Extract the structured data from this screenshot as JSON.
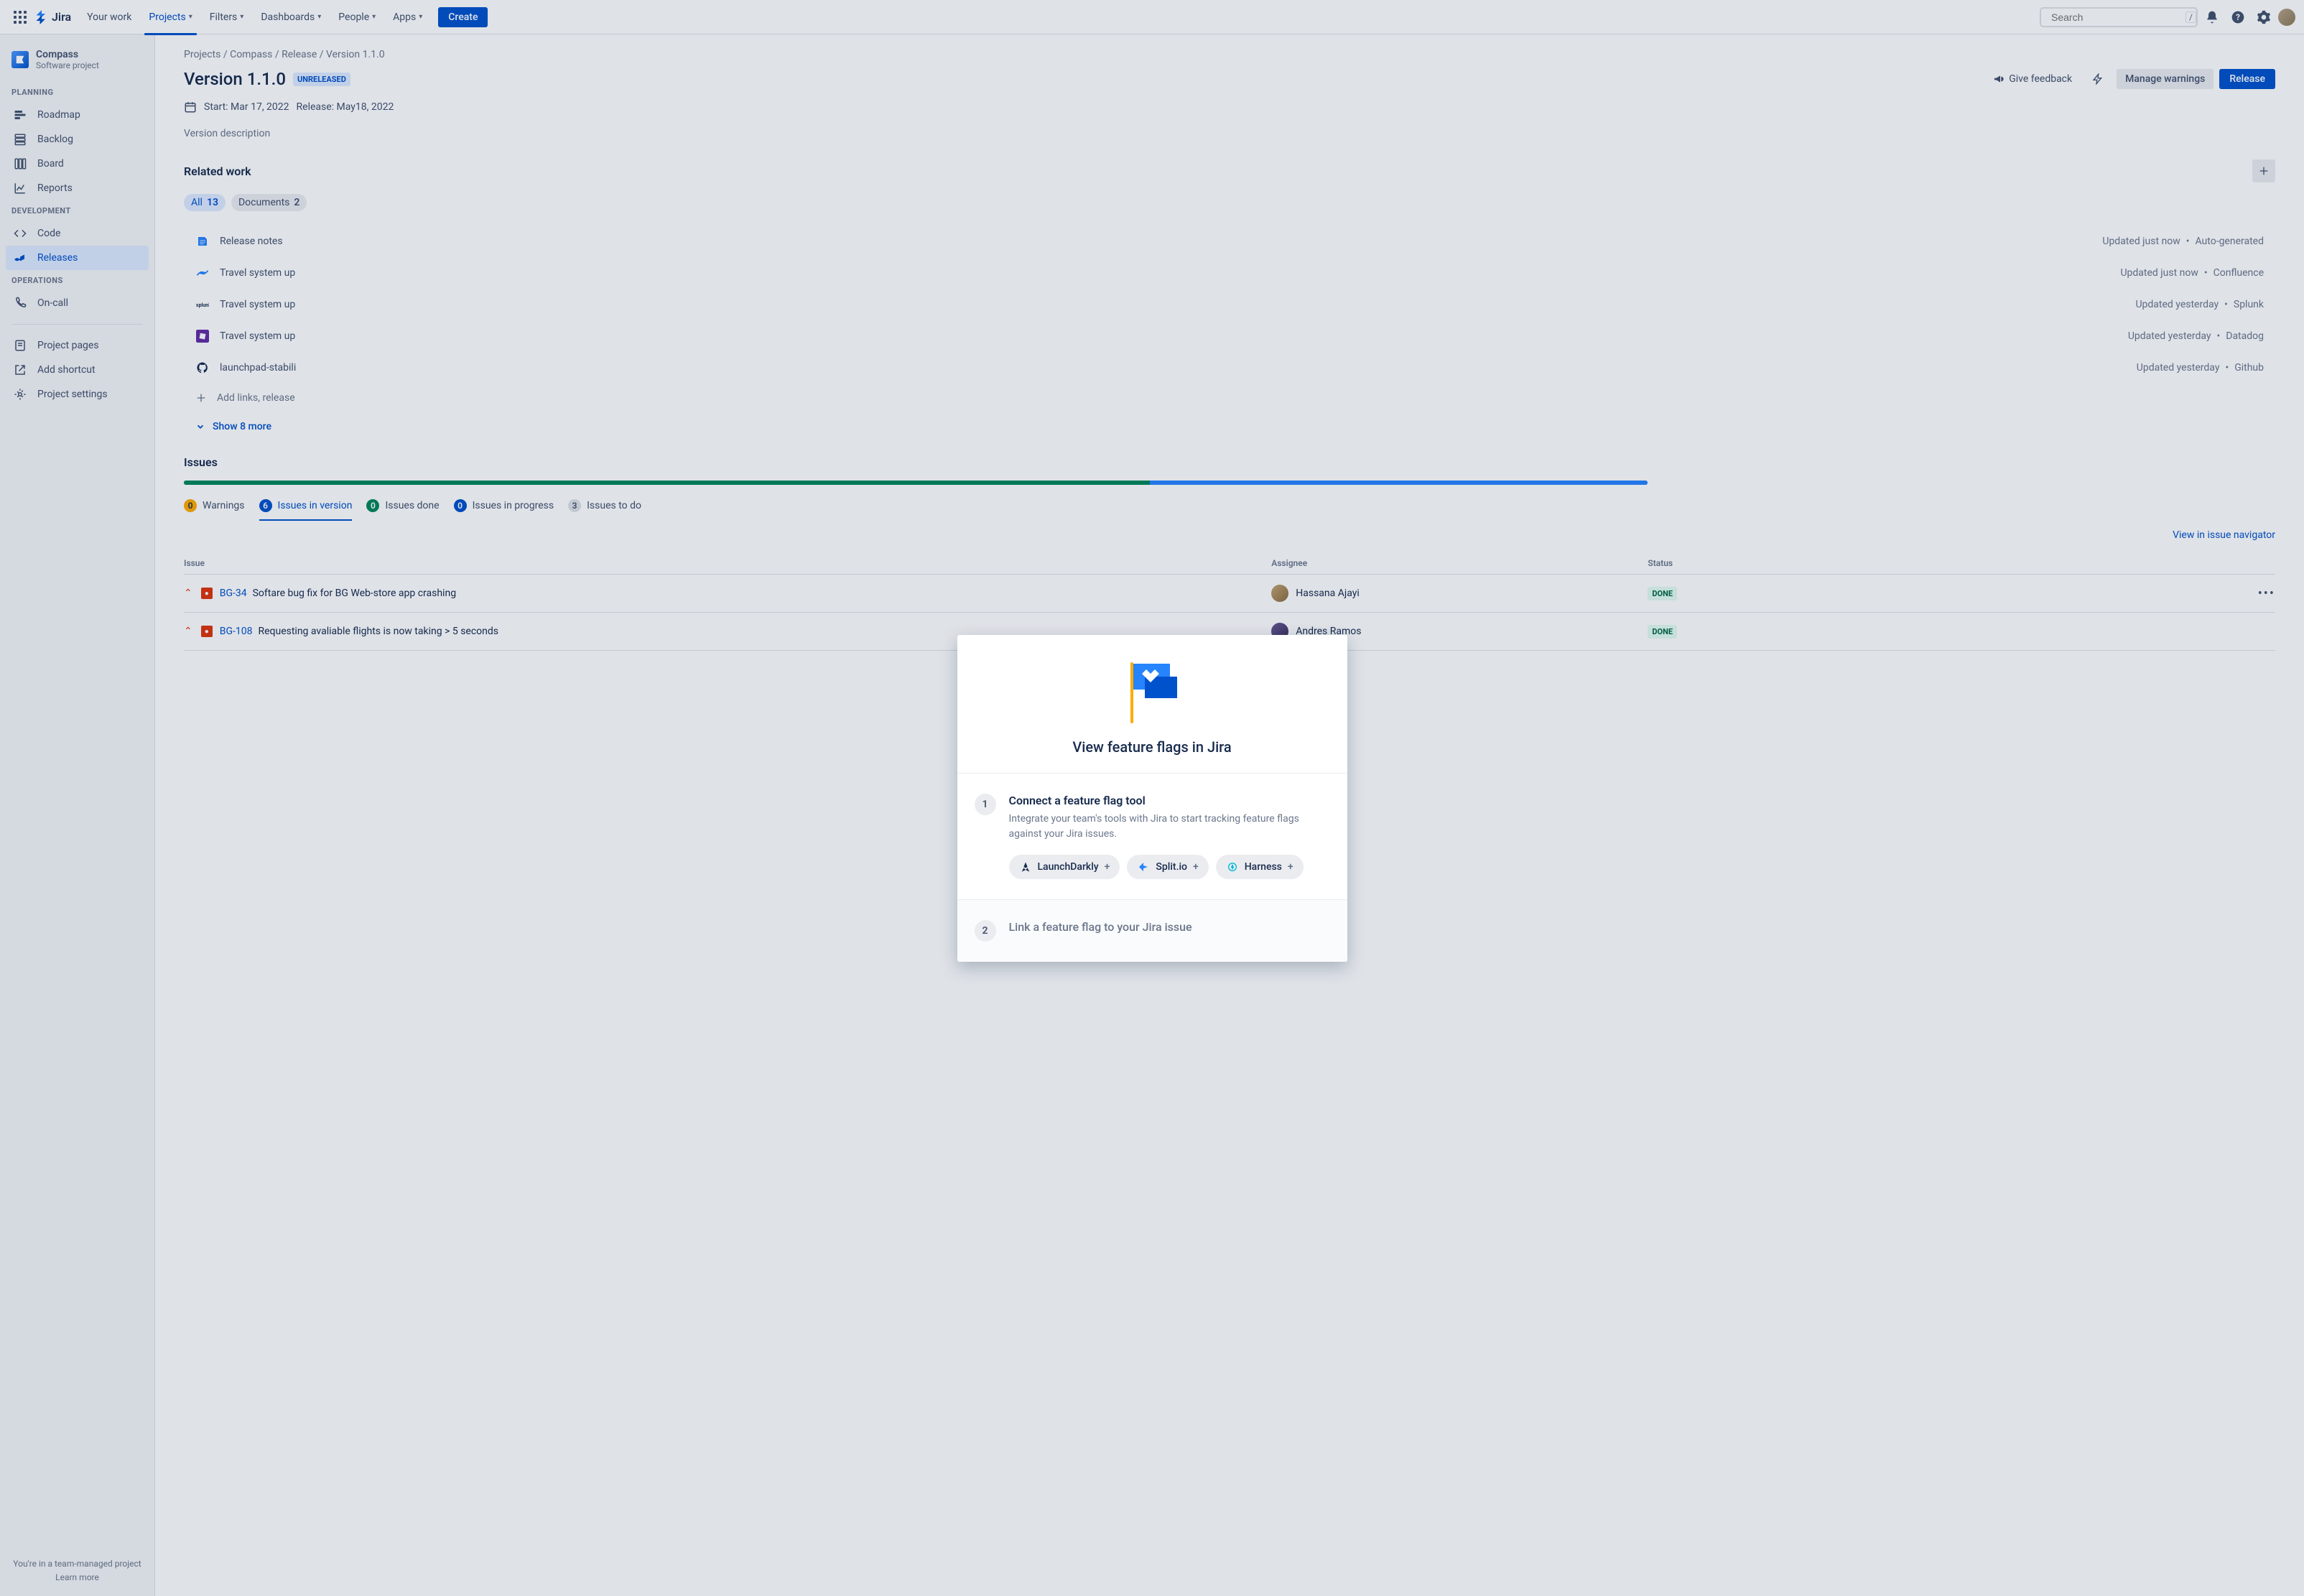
{
  "topnav": {
    "logo": "Jira",
    "items": [
      "Your work",
      "Projects",
      "Filters",
      "Dashboards",
      "People",
      "Apps"
    ],
    "active_index": 1,
    "create": "Create",
    "search_placeholder": "Search",
    "slash": "/"
  },
  "sidebar": {
    "project_name": "Compass",
    "project_type": "Software project",
    "sections": {
      "planning": {
        "label": "PLANNING",
        "items": [
          "Roadmap",
          "Backlog",
          "Board",
          "Reports"
        ]
      },
      "development": {
        "label": "DEVELOPMENT",
        "items": [
          "Code",
          "Releases"
        ],
        "active_index": 1
      },
      "operations": {
        "label": "OPERATIONS",
        "items": [
          "On-call"
        ]
      }
    },
    "bottom": [
      "Project pages",
      "Add shortcut",
      "Project settings"
    ],
    "footer_line1": "You're in a team-managed project",
    "footer_line2": "Learn more"
  },
  "breadcrumb": [
    "Projects",
    "Compass",
    "Release",
    "Version 1.1.0"
  ],
  "page": {
    "title": "Version 1.1.0",
    "status": "UNRELEASED",
    "feedback": "Give feedback",
    "manage_warnings": "Manage warnings",
    "release": "Release",
    "start": "Start: Mar 17, 2022",
    "release_date": "Release: May18, 2022",
    "desc_label": "Version description"
  },
  "related": {
    "title": "Related work",
    "chips": [
      {
        "label": "All",
        "count": "13",
        "active": true
      },
      {
        "label": "Documents",
        "count": "2",
        "active": false
      }
    ],
    "items": [
      {
        "title": "Release notes",
        "meta": "Updated just now",
        "source": "Auto-generated",
        "icon": "note"
      },
      {
        "title": "Travel system up",
        "meta": "Updated just now",
        "source": "Confluence",
        "icon": "confluence"
      },
      {
        "title": "Travel system up",
        "meta": "Updated yesterday",
        "source": "Splunk",
        "icon": "splunk"
      },
      {
        "title": "Travel system up",
        "meta": "Updated yesterday",
        "source": "Datadog",
        "icon": "datadog"
      },
      {
        "title": "launchpad-stabili",
        "meta": "Updated yesterday",
        "source": "Github",
        "icon": "github"
      }
    ],
    "add_links": "Add links, release",
    "show_more": "Show 8 more"
  },
  "issues": {
    "title": "Issues",
    "tabs": [
      {
        "count": "0",
        "label": "Warnings",
        "badge": "orange"
      },
      {
        "count": "6",
        "label": "Issues in version",
        "badge": "blue",
        "active": true
      },
      {
        "count": "0",
        "label": "Issues done",
        "badge": "green"
      },
      {
        "count": "0",
        "label": "Issues in progress",
        "badge": "blue"
      },
      {
        "count": "3",
        "label": "Issues to do",
        "badge": "gray"
      }
    ],
    "view_link": "View in issue navigator",
    "columns": {
      "issue": "Issue",
      "assignee": "Assignee",
      "status": "Status"
    },
    "rows": [
      {
        "key": "BG-34",
        "summary": "Softare bug fix for BG Web-store app crashing",
        "assignee": "Hassana Ajayi",
        "status": "DONE"
      },
      {
        "key": "BG-108",
        "summary": "Requesting avaliable flights is now taking > 5 seconds",
        "assignee": "Andres Ramos",
        "status": "DONE"
      }
    ]
  },
  "modal": {
    "title": "View feature flags in Jira",
    "step1": {
      "num": "1",
      "title": "Connect a feature flag tool",
      "desc": "Integrate your team's tools with Jira to start tracking feature flags against your Jira issues.",
      "tools": [
        "LaunchDarkly",
        "Split.io",
        "Harness"
      ]
    },
    "step2": {
      "num": "2",
      "title": "Link a feature flag to your Jira issue"
    }
  }
}
